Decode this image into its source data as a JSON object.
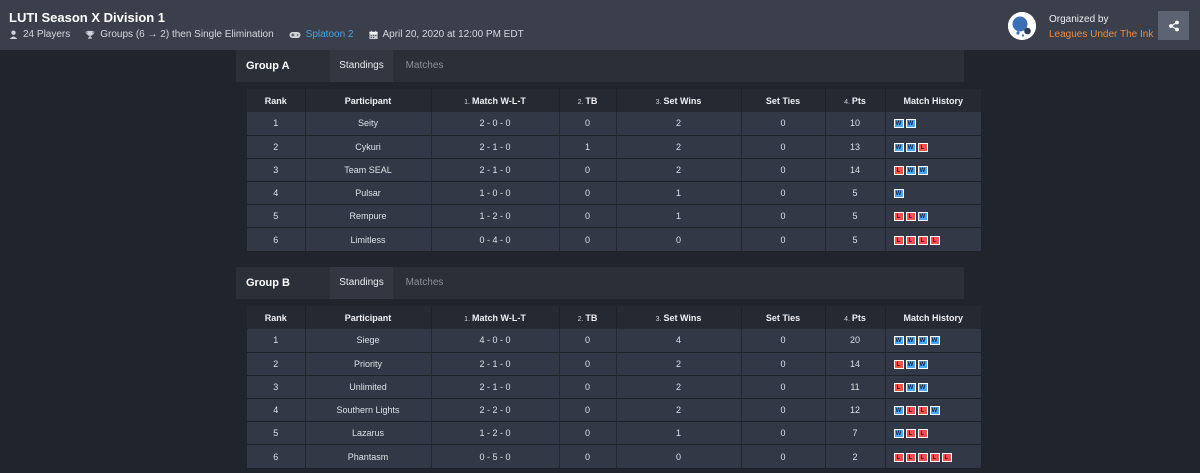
{
  "tournament": {
    "title": "LUTI Season X Division 1",
    "players": "24 Players",
    "format": "Groups (6 → 2) then Single Elimination",
    "game": "Splatoon 2",
    "date": "April 20, 2020 at 12:00 PM EDT"
  },
  "organizer": {
    "label": "Organized by",
    "name": "Leagues Under The Ink"
  },
  "colors": {
    "win": "#4ea6f5",
    "loss": "#f05252",
    "link": "#4aa3df",
    "organizer": "#f08a3c"
  },
  "icons": [
    "user-icon",
    "trophy-icon",
    "gamepad-icon",
    "calendar-icon",
    "organizer-logo",
    "share-icon"
  ],
  "columns": {
    "rank": "Rank",
    "participant": "Participant",
    "match_wlt": {
      "prefix": "1.",
      "label": "Match W-L-T"
    },
    "tb": {
      "prefix": "2.",
      "label": "TB"
    },
    "set_wins": {
      "prefix": "3.",
      "label": "Set Wins"
    },
    "set_ties": "Set Ties",
    "pts": {
      "prefix": "4.",
      "label": "Pts"
    },
    "history": "Match History"
  },
  "groups": [
    {
      "name": "Group A",
      "tabs": {
        "standings": "Standings",
        "matches": "Matches"
      },
      "rows": [
        {
          "rank": "1",
          "participant": "Seity",
          "wlt": "2 - 0 - 0",
          "tb": "0",
          "set_wins": "2",
          "set_ties": "0",
          "pts": "10",
          "history": [
            "W",
            "W"
          ]
        },
        {
          "rank": "2",
          "participant": "Cykuri",
          "wlt": "2 - 1 - 0",
          "tb": "1",
          "set_wins": "2",
          "set_ties": "0",
          "pts": "13",
          "history": [
            "W",
            "W",
            "L"
          ]
        },
        {
          "rank": "3",
          "participant": "Team SEAL",
          "wlt": "2 - 1 - 0",
          "tb": "0",
          "set_wins": "2",
          "set_ties": "0",
          "pts": "14",
          "history": [
            "L",
            "W",
            "W"
          ]
        },
        {
          "rank": "4",
          "participant": "Pulsar",
          "wlt": "1 - 0 - 0",
          "tb": "0",
          "set_wins": "1",
          "set_ties": "0",
          "pts": "5",
          "history": [
            "W"
          ]
        },
        {
          "rank": "5",
          "participant": "Rempure",
          "wlt": "1 - 2 - 0",
          "tb": "0",
          "set_wins": "1",
          "set_ties": "0",
          "pts": "5",
          "history": [
            "L",
            "L",
            "W"
          ]
        },
        {
          "rank": "6",
          "participant": "Limitless",
          "wlt": "0 - 4 - 0",
          "tb": "0",
          "set_wins": "0",
          "set_ties": "0",
          "pts": "5",
          "history": [
            "L",
            "L",
            "L",
            "L"
          ]
        }
      ]
    },
    {
      "name": "Group B",
      "tabs": {
        "standings": "Standings",
        "matches": "Matches"
      },
      "rows": [
        {
          "rank": "1",
          "participant": "Siege",
          "wlt": "4 - 0 - 0",
          "tb": "0",
          "set_wins": "4",
          "set_ties": "0",
          "pts": "20",
          "history": [
            "W",
            "W",
            "W",
            "W"
          ]
        },
        {
          "rank": "2",
          "participant": "Priority",
          "wlt": "2 - 1 - 0",
          "tb": "0",
          "set_wins": "2",
          "set_ties": "0",
          "pts": "14",
          "history": [
            "L",
            "W",
            "W"
          ]
        },
        {
          "rank": "3",
          "participant": "Unlimited",
          "wlt": "2 - 1 - 0",
          "tb": "0",
          "set_wins": "2",
          "set_ties": "0",
          "pts": "11",
          "history": [
            "L",
            "W",
            "W"
          ]
        },
        {
          "rank": "4",
          "participant": "Southern Lights",
          "wlt": "2 - 2 - 0",
          "tb": "0",
          "set_wins": "2",
          "set_ties": "0",
          "pts": "12",
          "history": [
            "W",
            "L",
            "L",
            "W"
          ]
        },
        {
          "rank": "5",
          "participant": "Lazarus",
          "wlt": "1 - 2 - 0",
          "tb": "0",
          "set_wins": "1",
          "set_ties": "0",
          "pts": "7",
          "history": [
            "W",
            "L",
            "L"
          ]
        },
        {
          "rank": "6",
          "participant": "Phantasm",
          "wlt": "0 - 5 - 0",
          "tb": "0",
          "set_wins": "0",
          "set_ties": "0",
          "pts": "2",
          "history": [
            "L",
            "L",
            "L",
            "L",
            "L"
          ]
        }
      ]
    }
  ]
}
